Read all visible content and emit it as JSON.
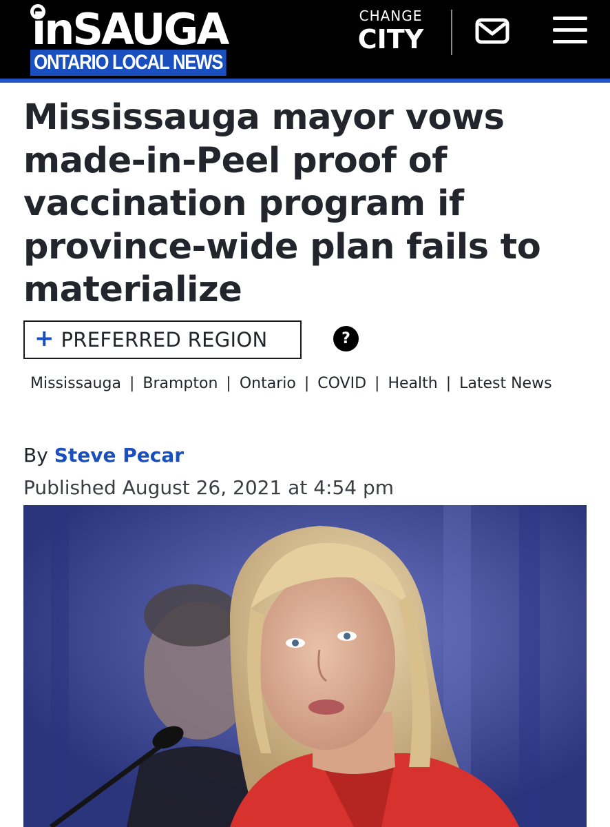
{
  "header": {
    "logo_main": "inSAUGA",
    "logo_sub": "ONTARIO LOCAL NEWS",
    "change_city_small": "CHANGE",
    "change_city_big": "CITY",
    "mail_icon": "envelope-icon",
    "menu_icon": "hamburger-menu-icon",
    "accent_color": "#1e56c8"
  },
  "article": {
    "title": "Mississauga mayor vows made-in-Peel proof of vaccination program if province-wide plan fails to materialize",
    "region_button_label": "PREFERRED REGION",
    "help_label": "?",
    "tags": [
      "Mississauga",
      "Brampton",
      "Ontario",
      "COVID",
      "Health",
      "Latest News"
    ],
    "byline_prefix": "By",
    "author": "Steve Pecar",
    "published": "Published August 26, 2021 at 4:54 pm"
  }
}
